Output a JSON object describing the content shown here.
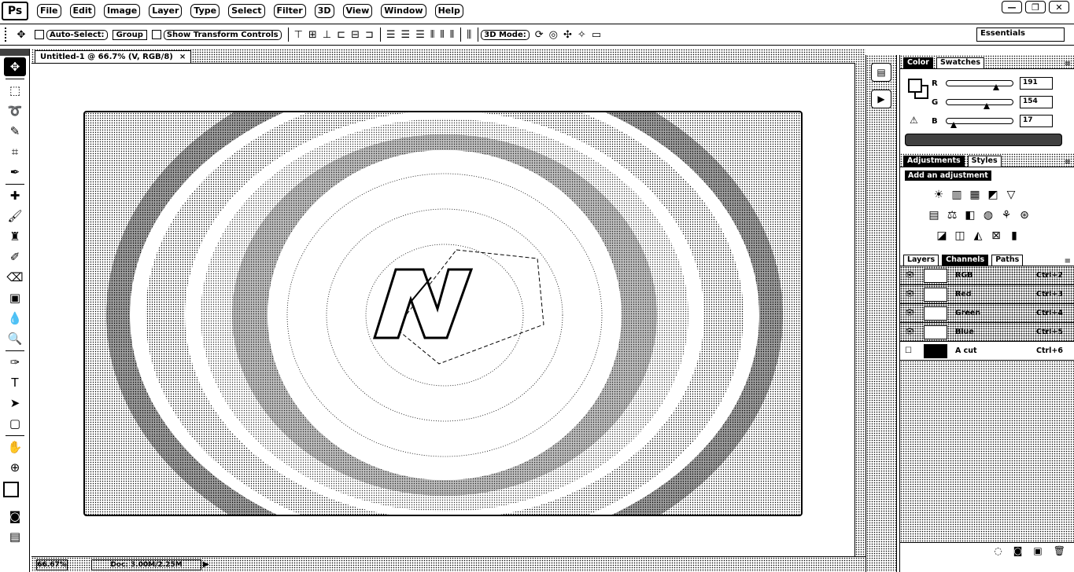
{
  "app": {
    "logo": "Ps"
  },
  "menu": [
    "File",
    "Edit",
    "Image",
    "Layer",
    "Type",
    "Select",
    "Filter",
    "3D",
    "View",
    "Window",
    "Help"
  ],
  "window_controls": [
    "—",
    "❐",
    "✕"
  ],
  "options": {
    "auto_select": "Auto-Select:",
    "auto_select_target": "Group",
    "show_transform": "Show Transform Controls",
    "mode_3d": "3D Mode:",
    "workspace": "Essentials"
  },
  "document": {
    "tab_title": "Untitled-1 @ 66.7% (V, RGB/8)",
    "tab_close": "×",
    "zoom": "66.67%",
    "doc_info": "Doc: 3.00M/2.25M"
  },
  "color_panel": {
    "tabs": [
      "Color",
      "Swatches"
    ],
    "sliders": [
      {
        "letter": "R",
        "value": "191",
        "position": 0.75
      },
      {
        "letter": "G",
        "value": "154",
        "position": 0.6
      },
      {
        "letter": "B",
        "value": "17",
        "position": 0.07
      }
    ]
  },
  "adjustments_panel": {
    "tabs": [
      "Adjustments",
      "Styles"
    ],
    "title": "Add an adjustment"
  },
  "layers_panel": {
    "tabs": [
      "Layers",
      "Channels",
      "Paths"
    ],
    "channels": [
      {
        "name": "RGB",
        "shortcut": "Ctrl+2"
      },
      {
        "name": "Red",
        "shortcut": "Ctrl+3"
      },
      {
        "name": "Green",
        "shortcut": "Ctrl+4"
      },
      {
        "name": "Blue",
        "shortcut": "Ctrl+5"
      },
      {
        "name": "A cut",
        "shortcut": "Ctrl+6"
      }
    ]
  }
}
